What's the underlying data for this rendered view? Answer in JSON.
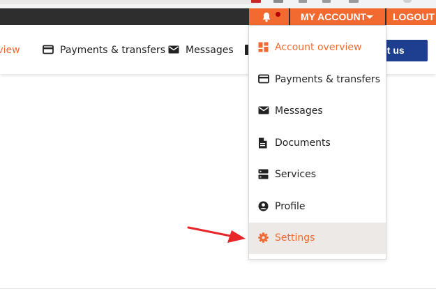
{
  "header": {
    "account_label": "MY ACCOUNT",
    "logout_label": "LOGOUT",
    "accent_color": "#f26a30",
    "bar_color": "#2e2e2e"
  },
  "nav": {
    "items": [
      {
        "label": "erview",
        "icon": "dashboard-icon",
        "active": true
      },
      {
        "label": "Payments & transfers",
        "icon": "credit-card-icon"
      },
      {
        "label": "Messages",
        "icon": "envelope-icon"
      }
    ],
    "contact_label": "ntact us",
    "contact_color": "#1e3f8f"
  },
  "dropdown": {
    "items": [
      {
        "label": "Account overview",
        "icon": "dashboard-icon",
        "state": "active"
      },
      {
        "label": "Payments & transfers",
        "icon": "credit-card-icon"
      },
      {
        "label": "Messages",
        "icon": "envelope-icon"
      },
      {
        "label": "Documents",
        "icon": "document-icon"
      },
      {
        "label": "Services",
        "icon": "server-icon"
      },
      {
        "label": "Profile",
        "icon": "user-circle-icon"
      },
      {
        "label": "Settings",
        "icon": "gear-icon",
        "state": "hovered"
      }
    ],
    "hover_bg": "#ede9e6"
  },
  "annotation": {
    "color": "#e8262a",
    "icon": "red-arrow"
  }
}
